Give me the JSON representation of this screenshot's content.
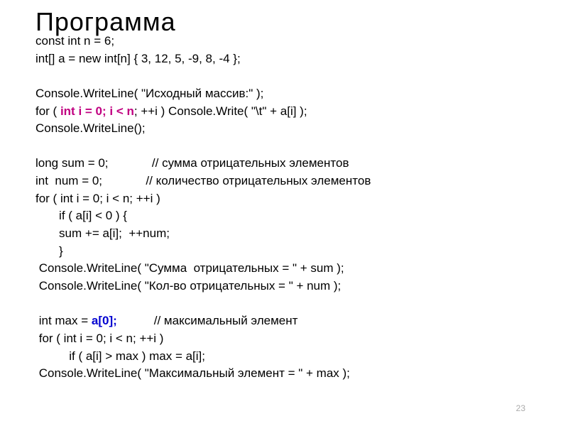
{
  "title": "Программа",
  "code": {
    "l1": "const int n = 6;",
    "l2": "int[] a = new int[n] { 3, 12, 5, -9, 8, -4 };",
    "l3": "",
    "l4a": "Console.WriteLine( \"Исходный массив:\" );",
    "l5a": "for ( ",
    "l5b": "int i = 0; i < n",
    "l5c": "; ++i ) Console.Write( \"\\t\" + a[i] );",
    "l6": "Console.WriteLine();",
    "l7": "",
    "l8": "long sum = 0;             // сумма отрицательных элементов",
    "l9": "int  num = 0;             // количество отрицательных элементов",
    "l10": "for ( int i = 0; i < n; ++i )",
    "l11": "       if ( a[i] < 0 ) {",
    "l12": "       sum += a[i];  ++num;",
    "l13": "       }",
    "l14": " Console.WriteLine( \"Сумма  отрицательных = \" + sum );",
    "l15": " Console.WriteLine( \"Кол-во отрицательных = \" + num );",
    "l16": "",
    "l17a": " int max = ",
    "l17b": "a[0];",
    "l17c": "           // максимальный элемент",
    "l18": " for ( int i = 0; i < n; ++i )",
    "l19": "          if ( a[i] > max ) max = a[i];",
    "l20": " Console.WriteLine( \"Максимальный элемент = \" + max );"
  },
  "page_number": "23"
}
